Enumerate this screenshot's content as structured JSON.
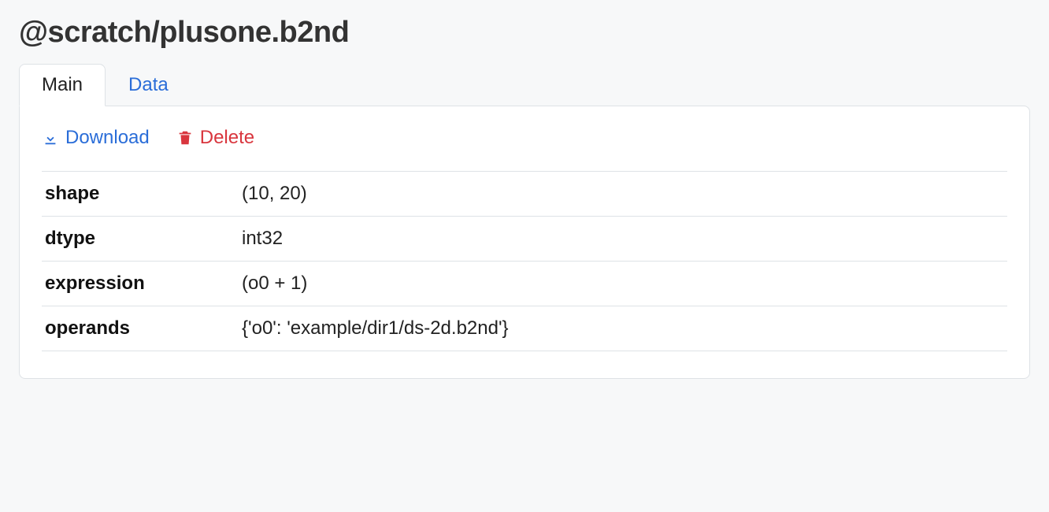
{
  "title": "@scratch/plusone.b2nd",
  "tabs": {
    "main": "Main",
    "data": "Data"
  },
  "actions": {
    "download": "Download",
    "delete": "Delete"
  },
  "meta": {
    "rows": [
      {
        "key": "shape",
        "value": "(10, 20)"
      },
      {
        "key": "dtype",
        "value": "int32"
      },
      {
        "key": "expression",
        "value": "(o0 + 1)"
      },
      {
        "key": "operands",
        "value": "{'o0': 'example/dir1/ds-2d.b2nd'}"
      }
    ]
  }
}
